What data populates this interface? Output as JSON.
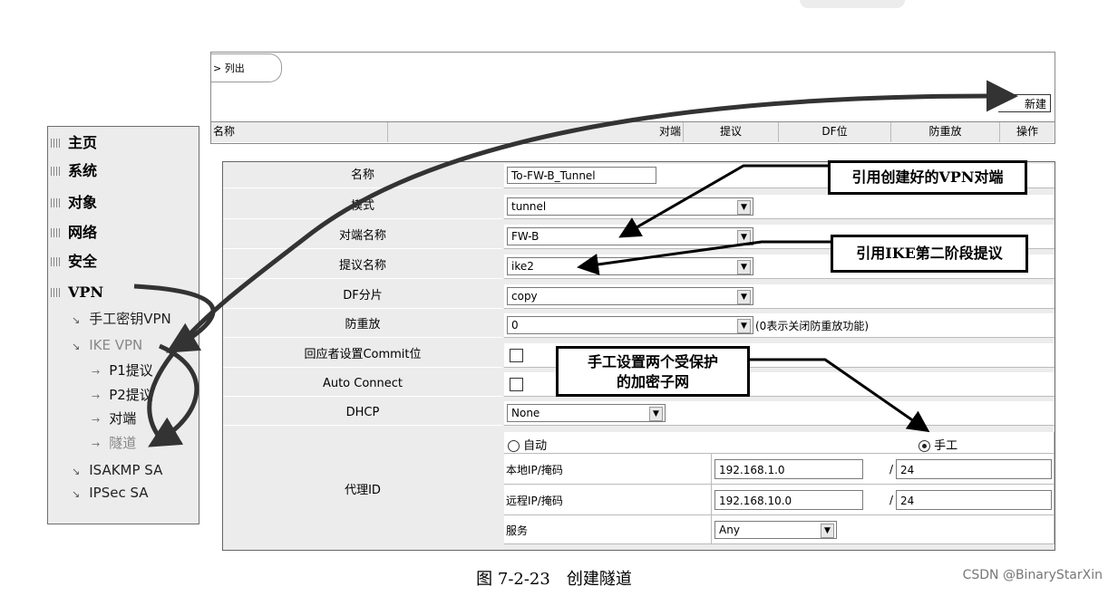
{
  "breadcrumb": "> 列出",
  "list": {
    "new_button": "新建",
    "columns": [
      "名称",
      "对端",
      "提议",
      "DF位",
      "防重放",
      "操作"
    ]
  },
  "sidebar": {
    "main_items": [
      "主页",
      "系统",
      "对象",
      "网络",
      "安全",
      "VPN"
    ],
    "vpn_items": [
      "手工密钥VPN",
      "IKE VPN"
    ],
    "ike_items": [
      "P1提议",
      "P2提议",
      "对端",
      "隧道"
    ],
    "bottom_items": [
      "ISAKMP SA",
      "IPSec SA"
    ]
  },
  "form": {
    "name_label": "名称",
    "name_value": "To-FW-B_Tunnel",
    "mode_label": "模式",
    "mode_value": "tunnel",
    "peer_label": "对端名称",
    "peer_value": "FW-B",
    "proposal_label": "提议名称",
    "proposal_value": "ike2",
    "df_label": "DF分片",
    "df_value": "copy",
    "replay_label": "防重放",
    "replay_value": "0",
    "replay_note": "(0表示关闭防重放功能)",
    "commit_label": "回应者设置Commit位",
    "autoconnect_label": "Auto Connect",
    "dhcp_label": "DHCP",
    "dhcp_value": "None",
    "proxy_label": "代理ID",
    "proxy_auto": "自动",
    "proxy_manual": "手工",
    "local_label": "本地IP/掩码",
    "local_ip": "192.168.1.0",
    "local_mask": "24",
    "remote_label": "远程IP/掩码",
    "remote_ip": "192.168.10.0",
    "remote_mask": "24",
    "service_label": "服务",
    "service_value": "Any",
    "slash": "/"
  },
  "callouts": {
    "peer_ref": "引用创建好的VPN对端",
    "ike_ref": "引用IKE第二阶段提议",
    "manual_line1": "手工设置两个受保护",
    "manual_line2": "的加密子网"
  },
  "caption": "图 7-2-23　创建隧道",
  "watermark": "CSDN @BinaryStarXin"
}
